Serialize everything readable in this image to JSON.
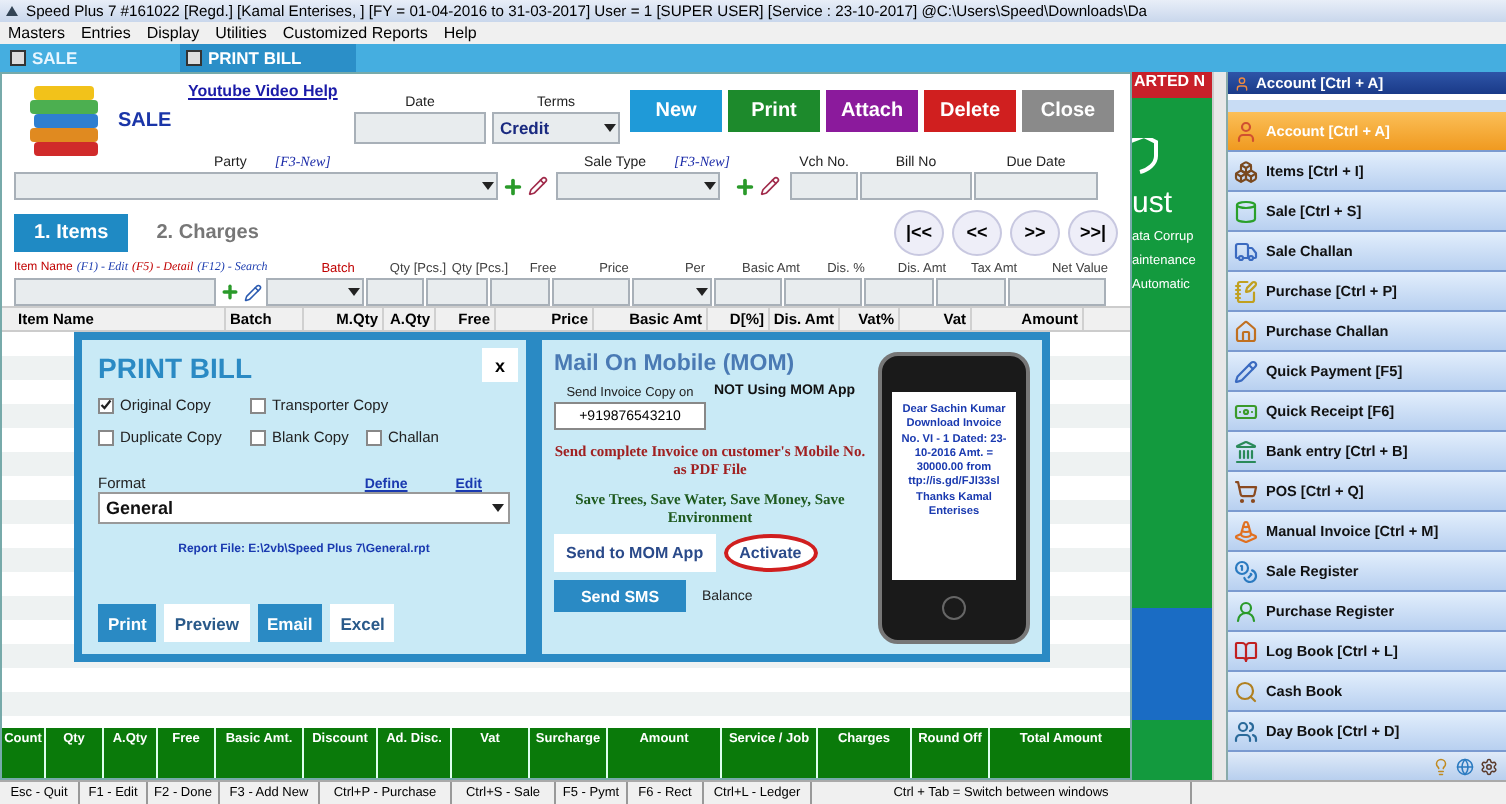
{
  "window": {
    "title": "Speed Plus 7 #161022  [Regd.]  [Kamal Enterises, ] [FY = 01-04-2016 to 31-03-2017] User = 1 [SUPER USER]   [Service : 23-10-2017]  @C:\\Users\\Speed\\Downloads\\Da"
  },
  "menu": [
    "Masters",
    "Entries",
    "Display",
    "Utilities",
    "Customized Reports",
    "Help"
  ],
  "doc_tabs": [
    {
      "label": "SALE",
      "selected": false
    },
    {
      "label": "PRINT BILL",
      "selected": true
    }
  ],
  "sale_form": {
    "title": "SALE",
    "help_link": "Youtube Video Help",
    "date_label": "Date",
    "terms": {
      "label": "Terms",
      "value": "Credit"
    },
    "buttons": [
      {
        "label": "New",
        "color": "#1f9ad8"
      },
      {
        "label": "Print",
        "color": "#1d8a2c"
      },
      {
        "label": "Attach",
        "color": "#8b1a9c"
      },
      {
        "label": "Delete",
        "color": "#d01f1f"
      },
      {
        "label": "Close",
        "color": "#8a8a8a"
      }
    ],
    "party": {
      "label": "Party",
      "hint": "[F3-New]"
    },
    "sale_type": {
      "label": "Sale Type",
      "hint": "[F3-New]"
    },
    "ref_fields": [
      "Vch No.",
      "Bill No",
      "Due Date"
    ],
    "section_tabs": [
      {
        "label": "1. Items",
        "selected": true
      },
      {
        "label": "2. Charges",
        "selected": false
      }
    ],
    "nav_buttons": [
      "|<<",
      "<<",
      ">>",
      ">>|"
    ],
    "item_hints": [
      {
        "text": "Item Name",
        "color": "#c00000"
      },
      {
        "text": "(F1) - Edit",
        "color": "#1f3fb0"
      },
      {
        "text": "(F5) - Detail",
        "color": "#c00000"
      },
      {
        "text": "(F12) - Search",
        "color": "#1f3fb0"
      }
    ],
    "entry_fields": [
      {
        "label": "Batch",
        "kind": "combo",
        "color": "#c00000"
      },
      {
        "label": "Qty [Pcs.]",
        "kind": "text",
        "color": "#404040"
      },
      {
        "label": "Qty [Pcs.]",
        "kind": "text",
        "color": "#404040"
      },
      {
        "label": "Free",
        "kind": "text",
        "color": "#404040"
      },
      {
        "label": "Price",
        "kind": "text",
        "color": "#404040"
      },
      {
        "label": "Per",
        "kind": "combo",
        "color": "#404040"
      },
      {
        "label": "Basic Amt",
        "kind": "text",
        "color": "#404040"
      },
      {
        "label": "Dis. %",
        "kind": "text",
        "color": "#404040"
      },
      {
        "label": "Dis. Amt",
        "kind": "text",
        "color": "#404040"
      },
      {
        "label": "Tax Amt",
        "kind": "text",
        "color": "#404040"
      },
      {
        "label": "Net Value",
        "kind": "text",
        "color": "#404040"
      }
    ],
    "grid": {
      "columns": [
        "Item Name",
        "Batch",
        "M.Qty",
        "A.Qty",
        "Free",
        "Price",
        "Basic Amt",
        "D[%]",
        "Dis. Amt",
        "Vat%",
        "Vat",
        "Amount"
      ]
    },
    "totals": [
      "Count",
      "Qty",
      "A.Qty",
      "Free",
      "Basic Amt.",
      "Discount",
      "Ad. Disc.",
      "Vat",
      "Surcharge",
      "Amount",
      "Service / Job",
      "Charges",
      "Round Off",
      "Total Amount"
    ]
  },
  "print_bill": {
    "title": "PRINT BILL",
    "close": "x",
    "options": [
      {
        "label": "Original Copy",
        "checked": true
      },
      {
        "label": "Transporter Copy",
        "checked": false
      },
      {
        "label": "Duplicate Copy",
        "checked": false
      },
      {
        "label": "Blank Copy",
        "checked": false
      },
      {
        "label": "Challan",
        "checked": false
      }
    ],
    "format": {
      "label": "Format",
      "value": "General"
    },
    "links": [
      "Define",
      "Edit"
    ],
    "report_file": "Report File: E:\\2vb\\Speed Plus 7\\General.rpt",
    "buttons": [
      {
        "label": "Print",
        "kind": "primary"
      },
      {
        "label": "Preview",
        "kind": "plain"
      },
      {
        "label": "Email",
        "kind": "primary"
      },
      {
        "label": "Excel",
        "kind": "plain"
      }
    ]
  },
  "mom": {
    "title": "Mail On Mobile  (MOM)",
    "phone_label": "Send Invoice Copy on",
    "phone": "+919876543210",
    "status": "NOT Using MOM App",
    "pitch": "Send complete Invoice on customer's Mobile No. as PDF File",
    "slogan": "Save Trees,  Save Water, Save Money, Save Environment",
    "buttons": [
      {
        "label": "Send to MOM App",
        "highlighted": false
      },
      {
        "label": "Activate",
        "highlighted": true
      }
    ],
    "sms_button": "Send SMS",
    "balance_label": "Balance",
    "sms_preview": "Dear Sachin Kumar Download Invoice No. VI - 1 Dated: 23-10-2016 Amt. = 30000.00 from ttp://is.gd/FJl33sl Thanks Kamal Enterises"
  },
  "backdrop": {
    "banner": "ARTED N",
    "heading": "ust",
    "lines": [
      "ata Corrup",
      "aintenance",
      "Automatic"
    ]
  },
  "sidebar": {
    "header": "Account [Ctrl + A]",
    "items": [
      {
        "label": "Account [Ctrl + A]",
        "selected": true
      },
      {
        "label": "Items [Ctrl + I]",
        "selected": false
      },
      {
        "label": "Sale [Ctrl + S]",
        "selected": false
      },
      {
        "label": "Sale Challan",
        "selected": false
      },
      {
        "label": "Purchase [Ctrl + P]",
        "selected": false
      },
      {
        "label": "Purchase Challan",
        "selected": false
      },
      {
        "label": "Quick Payment [F5]",
        "selected": false
      },
      {
        "label": "Quick Receipt [F6]",
        "selected": false
      },
      {
        "label": "Bank entry [Ctrl + B]",
        "selected": false
      },
      {
        "label": "POS [Ctrl + Q]",
        "selected": false
      },
      {
        "label": "Manual Invoice [Ctrl + M]",
        "selected": false
      },
      {
        "label": "Sale Register",
        "selected": false
      },
      {
        "label": "Purchase Register",
        "selected": false
      },
      {
        "label": "Log Book [Ctrl + L]",
        "selected": false
      },
      {
        "label": "Cash Book",
        "selected": false
      },
      {
        "label": "Day Book [Ctrl + D]",
        "selected": false
      }
    ]
  },
  "status_bar": [
    "Esc - Quit",
    "F1 - Edit",
    "F2 - Done",
    "F3 - Add New",
    "Ctrl+P - Purchase",
    "Ctrl+S - Sale",
    "F5 - Pymt",
    "F6 - Rect",
    "Ctrl+L - Ledger",
    "Ctrl + Tab = Switch between windows"
  ]
}
